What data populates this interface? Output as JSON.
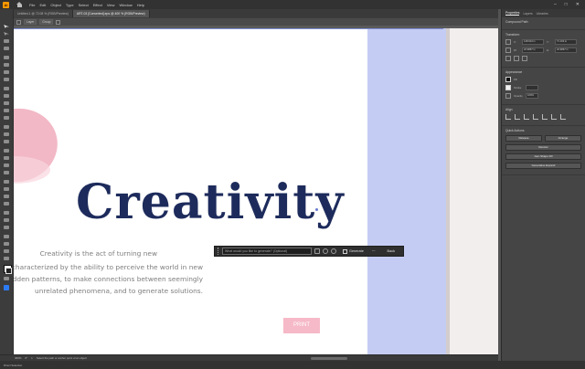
{
  "menubar": {
    "logo": "Ai",
    "items": [
      "File",
      "Edit",
      "Object",
      "Type",
      "Select",
      "Effect",
      "View",
      "Window",
      "Help"
    ],
    "window_controls": [
      "–",
      "□",
      "✕"
    ]
  },
  "tabs": [
    {
      "label": "Untitled-1 @ 72.08 % (RGB/Preview)",
      "active": false
    },
    {
      "label": "ART-03 [Converted].eps @ 400 % (RGB/Preview)",
      "active": true
    }
  ],
  "crumbs": [
    "Layer",
    "Group"
  ],
  "canvas": {
    "headline": "Creativity",
    "body_lines": [
      "Creativity is the act of turning new",
      "Creativity is characterized by the ability to perceive the world in new",
      "ways, to find hidden patterns, to make connections between seemingly",
      "unrelated phenomena, and to generate solutions."
    ],
    "print_button": "PRINT"
  },
  "context_bar": {
    "prompt_placeholder": "What would you like to generate? (Optional)",
    "generate_label": "Generate",
    "more": "···",
    "back_label": "Back"
  },
  "status": {
    "zoom": "400%",
    "angle": "0°",
    "artboard": "1",
    "tip": "Select the path or anchor point of an object",
    "tool": "Direct Selection"
  },
  "properties": {
    "tabs": [
      "Properties",
      "Layers",
      "Libraries"
    ],
    "object_type": "Compound Path",
    "transform_title": "Transform",
    "transform": {
      "x": "148.913 in",
      "y": "71.163 in",
      "w": "22.9867 in",
      "h": "22.9867 in"
    },
    "appearance_title": "Appearance",
    "fill_label": "Fill",
    "stroke_label": "Stroke",
    "opacity_label": "Opacity",
    "opacity_value": "100%",
    "align_title": "Align",
    "quick_actions_title": "Quick Actions",
    "release_label": "Release",
    "arrange_label": "Arrange",
    "recolor_label": "Recolor",
    "shape_fill_label": "Gen Shape Fill",
    "gen_expand_label": "Generative Expand"
  }
}
